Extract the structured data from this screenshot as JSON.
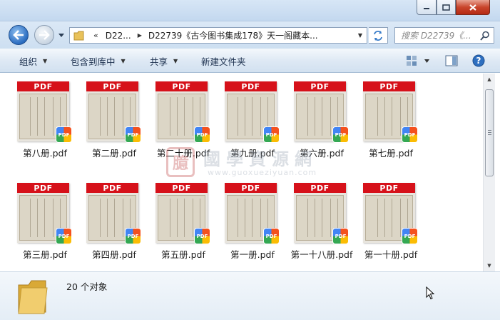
{
  "window": {
    "controls": {
      "minimize_icon": "minimize-icon",
      "maximize_icon": "maximize-icon",
      "close_icon": "close-icon"
    }
  },
  "address_bar": {
    "overflow": "«",
    "crumbs": [
      "D22...",
      "D22739《古今图书集成178》天一阁藏本..."
    ]
  },
  "search": {
    "placeholder": "搜索 D22739《..."
  },
  "toolbar": {
    "organize": "组织",
    "include_in_library": "包含到库中",
    "share": "共享",
    "new_folder": "新建文件夹"
  },
  "files": [
    {
      "name": "第八册.pdf",
      "badge": "PDF"
    },
    {
      "name": "第二册.pdf",
      "badge": "PDF"
    },
    {
      "name": "第二十册.pdf",
      "badge": "PDF"
    },
    {
      "name": "第九册.pdf",
      "badge": "PDF"
    },
    {
      "name": "第六册.pdf",
      "badge": "PDF"
    },
    {
      "name": "第七册.pdf",
      "badge": "PDF"
    },
    {
      "name": "第三册.pdf",
      "badge": "PDF"
    },
    {
      "name": "第四册.pdf",
      "badge": "PDF"
    },
    {
      "name": "第五册.pdf",
      "badge": "PDF"
    },
    {
      "name": "第一册.pdf",
      "badge": "PDF"
    },
    {
      "name": "第一十八册.pdf",
      "badge": "PDF"
    },
    {
      "name": "第一十册.pdf",
      "badge": "PDF"
    }
  ],
  "watermark": {
    "seal": "臆",
    "title": "國學資源網",
    "url": "www.guoxueziyuan.com"
  },
  "details": {
    "count": "20 个对象"
  },
  "colors": {
    "pdf_band": "#d6111a",
    "toolbar_text": "#1e3250"
  }
}
